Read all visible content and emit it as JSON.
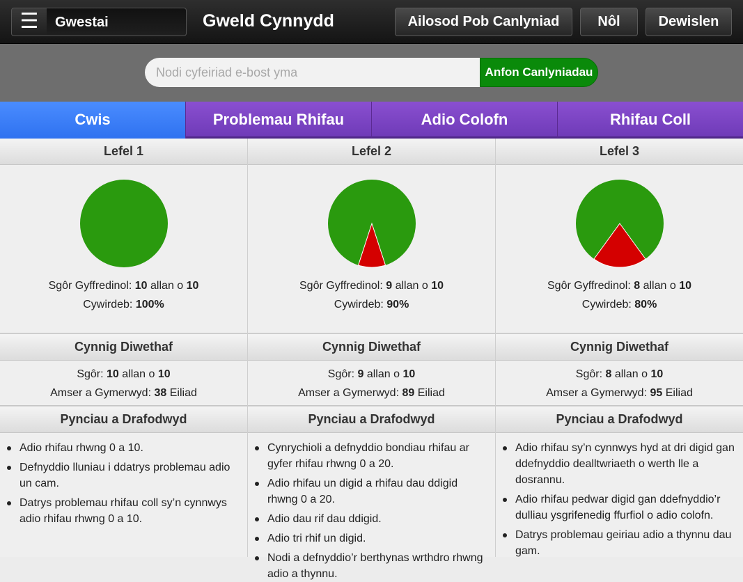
{
  "header": {
    "menu_icon": "☰",
    "user_name": "Gwestai",
    "title": "Gweld Cynnydd",
    "reset_label": "Ailosod Pob Canlyniad",
    "back_label": "Nôl",
    "menu_label": "Dewislen"
  },
  "email": {
    "placeholder": "Nodi cyfeiriad e-bost yma",
    "value": "",
    "send_label": "Anfon Canlyniadau"
  },
  "tabs": [
    {
      "label": "Cwis",
      "active": true
    },
    {
      "label": "Problemau Rhifau",
      "active": false
    },
    {
      "label": "Adio Colofn",
      "active": false
    },
    {
      "label": "Rhifau Coll",
      "active": false
    }
  ],
  "colors": {
    "correct": "#2a9a0e",
    "incorrect": "#d40000",
    "active_tab": "#3b7ff8",
    "inactive_tab": "#7d45c4",
    "send_button": "#0a8a0a"
  },
  "labels": {
    "overall_score": "Sgôr Gyffredinol:",
    "out_of": "allan o",
    "accuracy": "Cywirdeb:",
    "last_attempt": "Cynnig Diwethaf",
    "score": "Sgôr:",
    "time_taken": "Amser a Gymerwyd:",
    "seconds": "Eiliad",
    "topics": "Pynciau a Drafodwyd"
  },
  "levels": [
    {
      "title": "Lefel 1",
      "overall_score": "10",
      "overall_total": "10",
      "accuracy": "100%",
      "accuracy_fraction": 1.0,
      "last_score": "10",
      "last_total": "10",
      "time": "38",
      "topics": [
        "Adio rhifau rhwng 0 a 10.",
        "Defnyddio lluniau i ddatrys problemau adio un cam.",
        "Datrys problemau rhifau coll sy’n cynnwys adio rhifau rhwng 0 a 10."
      ]
    },
    {
      "title": "Lefel 2",
      "overall_score": "9",
      "overall_total": "10",
      "accuracy": "90%",
      "accuracy_fraction": 0.9,
      "last_score": "9",
      "last_total": "10",
      "time": "89",
      "topics": [
        "Cynrychioli a defnyddio bondiau rhifau ar gyfer rhifau rhwng 0 a 20.",
        "Adio rhifau un digid a rhifau dau ddigid rhwng 0 a 20.",
        "Adio dau rif dau ddigid.",
        "Adio tri rhif un digid.",
        "Nodi a defnyddio’r berthynas wrthdro rhwng adio a thynnu."
      ]
    },
    {
      "title": "Lefel 3",
      "overall_score": "8",
      "overall_total": "10",
      "accuracy": "80%",
      "accuracy_fraction": 0.8,
      "last_score": "8",
      "last_total": "10",
      "time": "95",
      "topics": [
        "Adio rhifau sy’n cynnwys hyd at dri digid gan ddefnyddio dealltwriaeth o werth lle a dosrannu.",
        "Adio rhifau pedwar digid gan ddefnyddio’r dulliau ysgrifenedig ffurfiol o adio colofn.",
        "Datrys problemau geiriau adio a thynnu dau gam."
      ]
    }
  ]
}
